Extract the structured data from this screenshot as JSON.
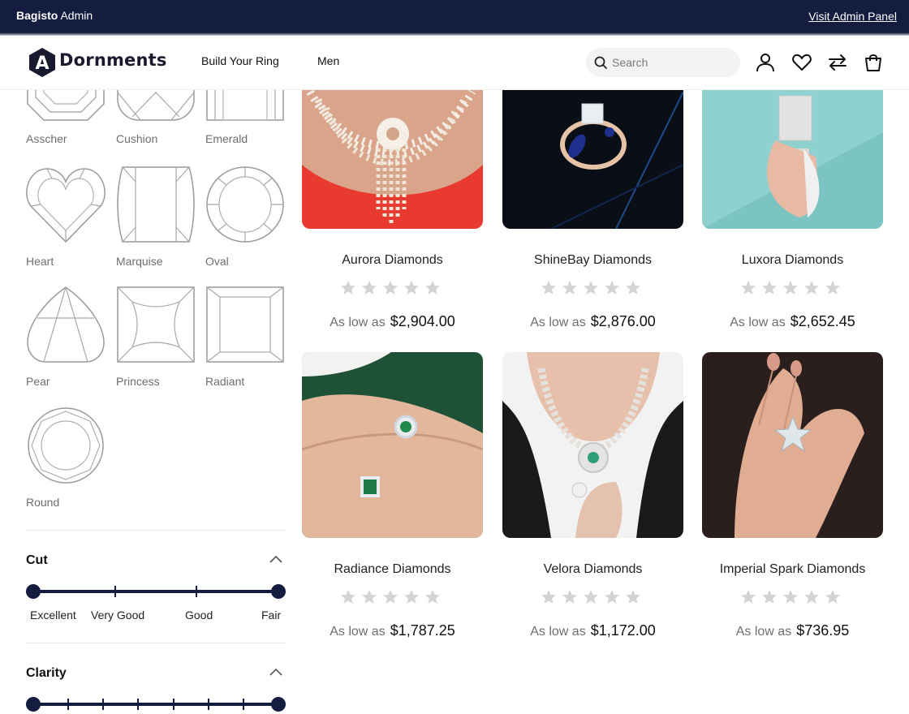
{
  "admin_bar": {
    "brand_bold": "Bagisto",
    "brand_rest": " Admin",
    "visit_link": "Visit Admin Panel"
  },
  "header": {
    "logo_text": "Dornments",
    "logo_mark": "A",
    "nav": [
      {
        "label": "Build Your Ring"
      },
      {
        "label": "Men"
      }
    ],
    "search_placeholder": "Search",
    "icons": [
      "user-icon",
      "heart-icon",
      "compare-icon",
      "cart-icon"
    ]
  },
  "sidebar": {
    "shapes": [
      {
        "label": "Asscher"
      },
      {
        "label": "Cushion"
      },
      {
        "label": "Emerald"
      },
      {
        "label": "Heart"
      },
      {
        "label": "Marquise"
      },
      {
        "label": "Oval"
      },
      {
        "label": "Pear"
      },
      {
        "label": "Princess"
      },
      {
        "label": "Radiant"
      },
      {
        "label": "Round"
      }
    ],
    "cut": {
      "title": "Cut",
      "stops": [
        "Excellent",
        "Very Good",
        "Good",
        "Fair"
      ],
      "selected_min": "Excellent",
      "selected_max": "Fair"
    },
    "clarity": {
      "title": "Clarity"
    }
  },
  "products": [
    {
      "name": "Aurora Diamonds",
      "as_low_as": "As low as",
      "price": "$2,904.00",
      "rating": 0
    },
    {
      "name": "ShineBay Diamonds",
      "as_low_as": "As low as",
      "price": "$2,876.00",
      "rating": 0
    },
    {
      "name": "Luxora Diamonds",
      "as_low_as": "As low as",
      "price": "$2,652.45",
      "rating": 0
    },
    {
      "name": "Radiance Diamonds",
      "as_low_as": "As low as",
      "price": "$1,787.25",
      "rating": 0
    },
    {
      "name": "Velora Diamonds",
      "as_low_as": "As low as",
      "price": "$1,172.00",
      "rating": 0
    },
    {
      "name": "Imperial Spark Diamonds",
      "as_low_as": "As low as",
      "price": "$736.95",
      "rating": 0
    }
  ],
  "colors": {
    "admin_bar": "#141c3f",
    "accent": "#141c3f",
    "star": "#d4d4d4"
  }
}
